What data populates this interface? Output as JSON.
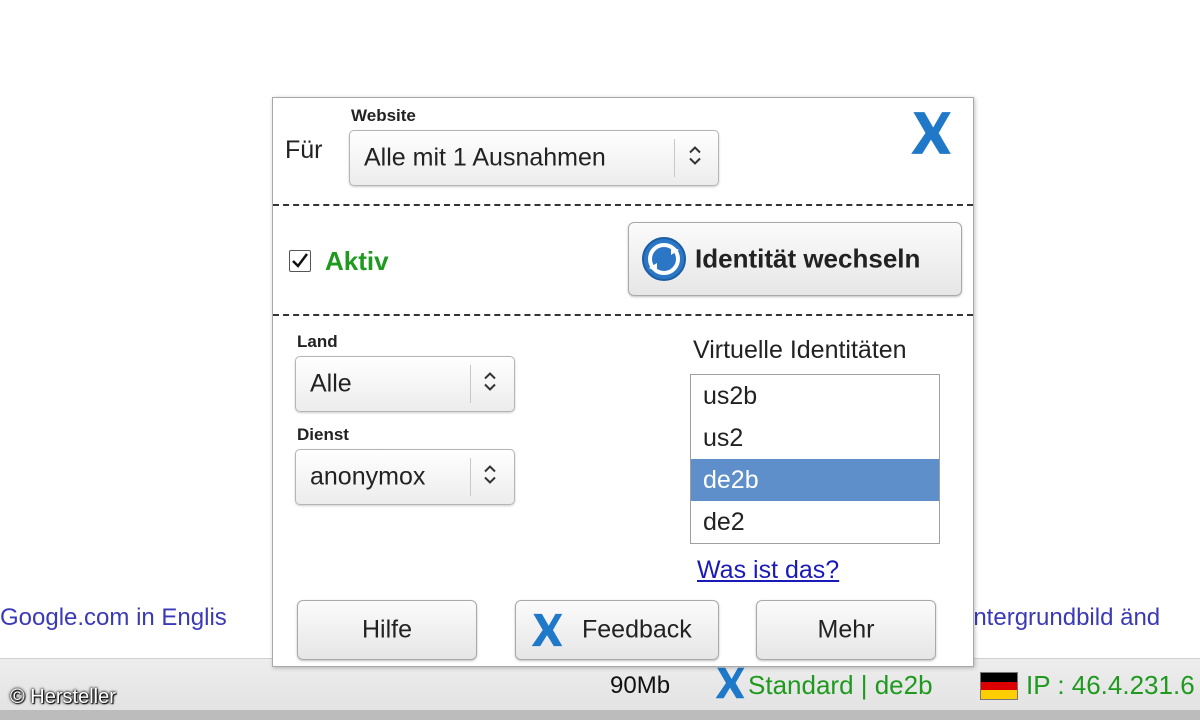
{
  "background": {
    "left_link": "Google.com in Englis",
    "right_link": "intergrundbild änd"
  },
  "statusbar": {
    "credit": "© Hersteller",
    "memory": "90Mb",
    "logo_icon": "anonymox-x-icon",
    "profile": "Standard | de2b",
    "flag_icon": "germany-flag-icon",
    "ip": "IP : 46.4.231.6"
  },
  "popup": {
    "for_label": "Für",
    "website_label": "Website",
    "website_select": "Alle mit 1 Ausnahmen",
    "logo_icon": "anonymox-x-icon",
    "active_checked": true,
    "active_label": "Aktiv",
    "switch_button": "Identität wechseln",
    "switch_icon": "refresh-globe-icon",
    "country_label": "Land",
    "country_select": "Alle",
    "service_label": "Dienst",
    "service_select": "anonymox",
    "identities_title": "Virtuelle Identitäten",
    "identities": [
      "us2b",
      "us2",
      "de2b",
      "de2"
    ],
    "selected_identity": "de2b",
    "help_link": "Was ist das?",
    "buttons": {
      "help": "Hilfe",
      "feedback": "Feedback",
      "more": "Mehr"
    }
  },
  "colors": {
    "accent_green": "#1f9a1f",
    "selection_blue": "#5f8fca",
    "logo_blue": "#1f78c8",
    "link_blue": "#1a1ab8"
  }
}
